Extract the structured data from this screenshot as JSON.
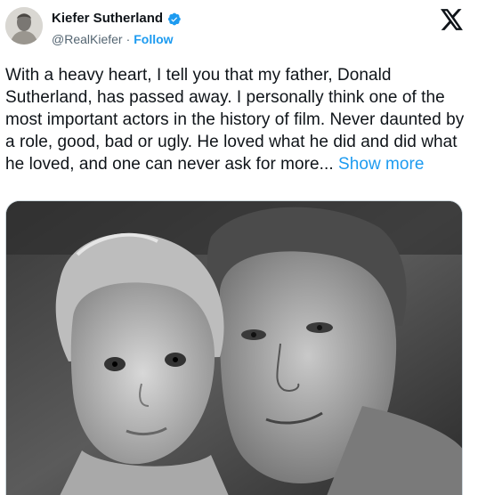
{
  "tweet": {
    "author": {
      "display_name": "Kiefer Sutherland",
      "handle": "@RealKiefer",
      "separator": "·",
      "follow_label": "Follow",
      "verified": true
    },
    "text": "With a heavy heart, I tell you that my father, Donald Sutherland, has passed away. I personally think one of the most important actors in the history of film. Never daunted by a role, good, bad or ugly. He loved what he did and did what he loved, and one can never ask for more...",
    "show_more_label": "Show more",
    "media": {
      "type": "photo",
      "icon": "black-and-white-photo"
    }
  },
  "colors": {
    "text": "#0f1419",
    "secondary": "#536471",
    "link": "#1d9bf0",
    "verified": "#1d9bf0",
    "border": "#cfd9de"
  },
  "icons": {
    "platform": "x-logo-icon",
    "verified": "verified-badge-icon"
  }
}
